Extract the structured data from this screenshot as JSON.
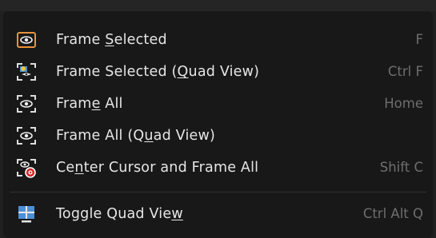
{
  "menu": {
    "items": [
      {
        "label_pre": "Frame ",
        "label_mnemonic": "S",
        "label_post": "elected",
        "shortcut": "F",
        "icon": "frame-selected-icon"
      },
      {
        "label_pre": "Frame Selected (",
        "label_mnemonic": "Q",
        "label_post": "uad View)",
        "shortcut": "Ctrl F",
        "icon": "frame-selected-quad-icon"
      },
      {
        "label_pre": "Fram",
        "label_mnemonic": "e",
        "label_post": " All",
        "shortcut": "Home",
        "icon": "frame-all-icon"
      },
      {
        "label_pre": "Frame All (Q",
        "label_mnemonic": "u",
        "label_post": "ad View)",
        "shortcut": "",
        "icon": "frame-all-quad-icon"
      },
      {
        "label_pre": "Ce",
        "label_mnemonic": "n",
        "label_post": "ter Cursor and Frame All",
        "shortcut": "Shift C",
        "icon": "center-cursor-icon"
      },
      {
        "label_pre": "Toggle Quad Vie",
        "label_mnemonic": "w",
        "label_post": "",
        "shortcut": "Ctrl Alt Q",
        "icon": "toggle-quad-view-icon"
      }
    ]
  },
  "colors": {
    "menu_bg": "#181818",
    "text": "#e6e6e6",
    "shortcut_text": "#6e6e6e",
    "icon_orange": "#e8923a",
    "icon_blue": "#4d8fd6",
    "icon_red": "#d12a2a"
  }
}
